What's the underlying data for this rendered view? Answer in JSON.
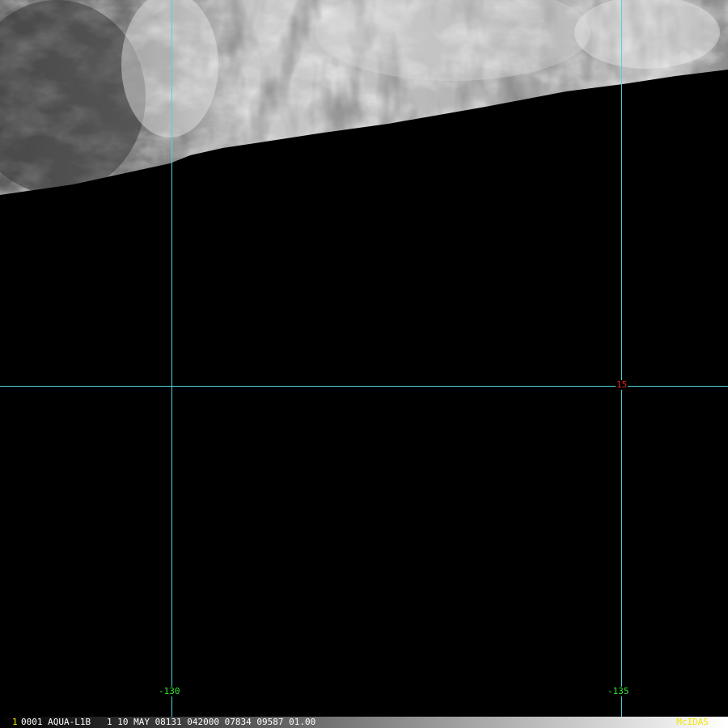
{
  "image_viewer": {
    "satellite_image": {
      "sensor": "AQUA-L1B",
      "description": "grayscale satellite imagery"
    },
    "graticule": {
      "line_color": "#4fd3dd",
      "longitude_labels": [
        "-130",
        "-135"
      ],
      "latitude_labels": [
        "15"
      ],
      "longitude_label_color": "#2ee82e",
      "latitude_label_color": "#e02020"
    }
  },
  "status_bar": {
    "frame_number": "1",
    "image_info": "0001 AQUA-L1B   1 10 MAY 08131 042000 07834 09587 01.00",
    "logo": "McIDAS",
    "text_color": "#ffffff",
    "highlight_color": "#f2e600"
  }
}
